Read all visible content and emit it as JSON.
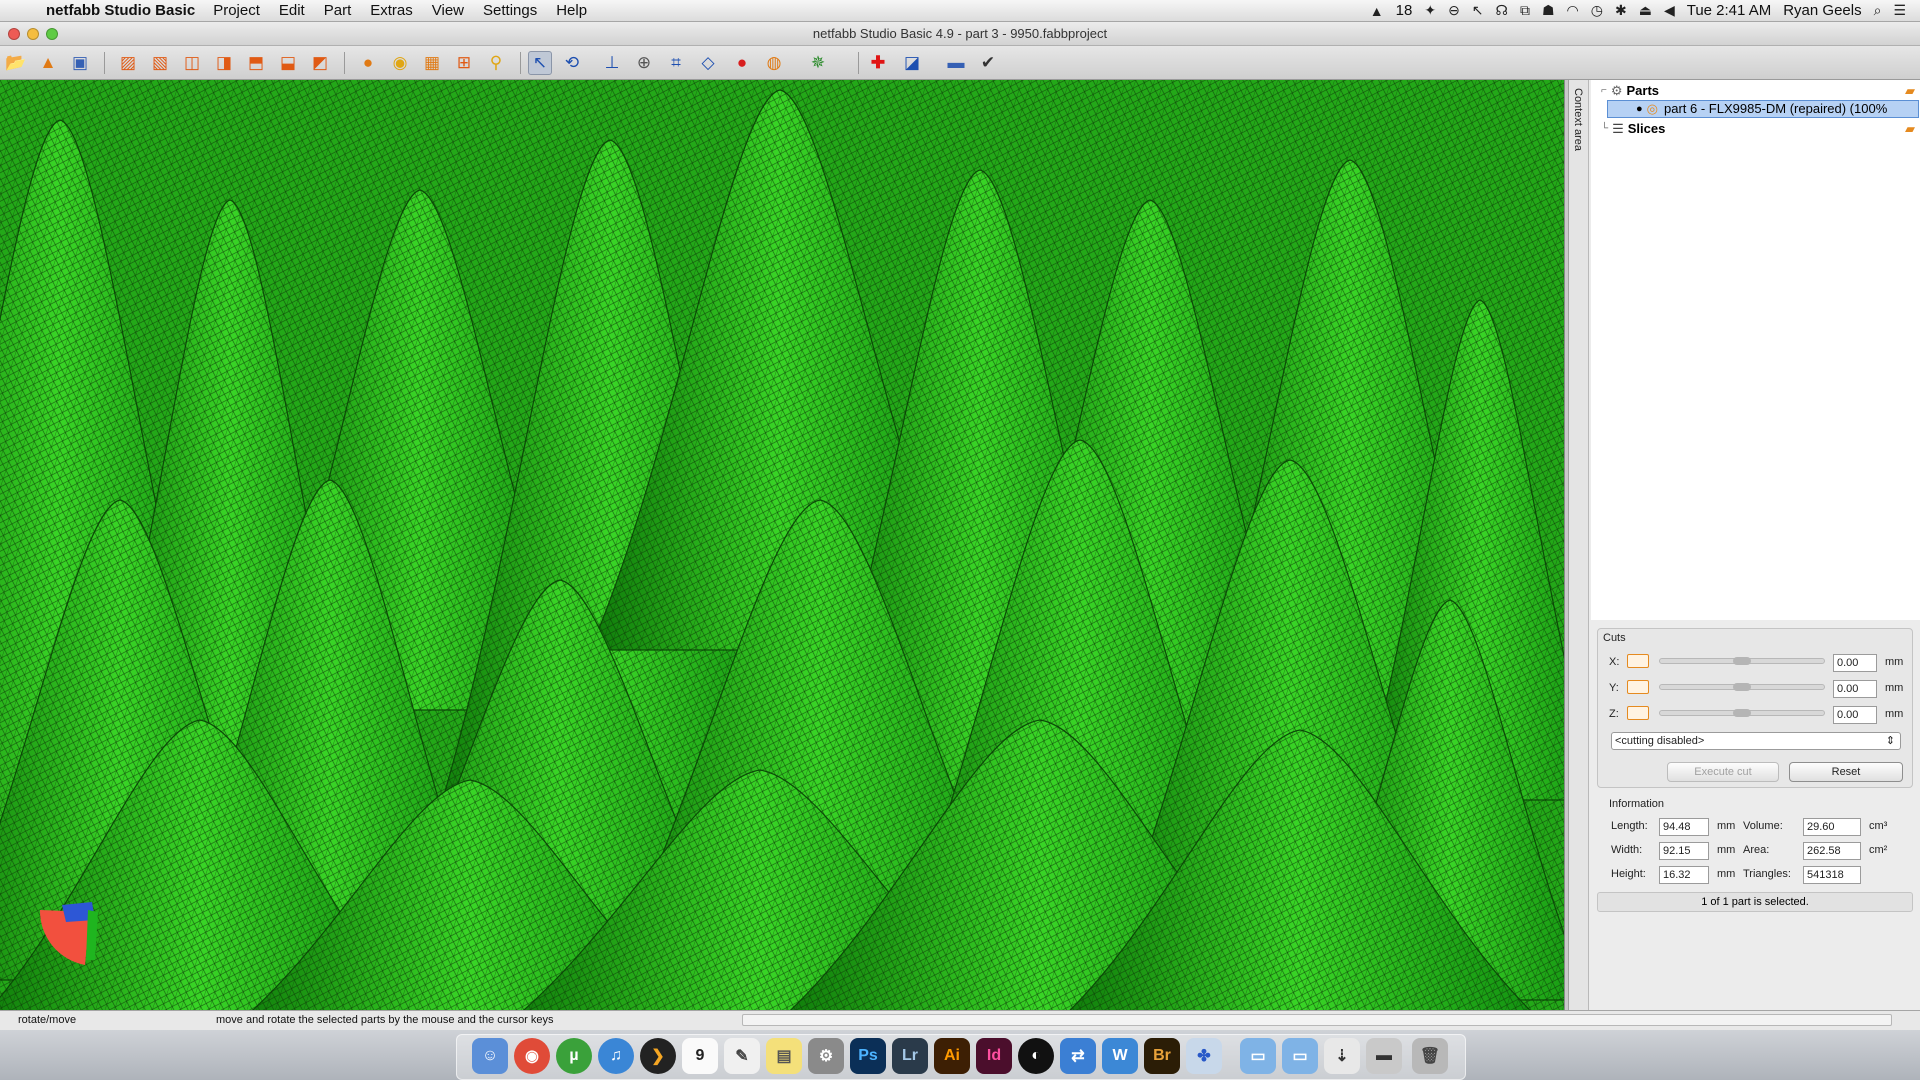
{
  "menubar": {
    "apple_icon": "apple-icon",
    "app_name": "netfabb Studio Basic",
    "menus": [
      "Project",
      "Edit",
      "Part",
      "Extras",
      "View",
      "Settings",
      "Help"
    ],
    "tray": {
      "notification_count": "18",
      "clock": "Tue 2:41 AM",
      "user": "Ryan Geels"
    }
  },
  "window": {
    "title": "netfabb Studio Basic 4.9 - part 3 - 9950.fabbproject"
  },
  "toolbar": {
    "buttons": [
      "open-project-icon",
      "add-part-icon",
      "import-icon",
      "view-front-icon",
      "view-back-icon",
      "view-left-icon",
      "view-right-icon",
      "view-top-icon",
      "view-bottom-icon",
      "view-iso-icon",
      "sphere-shade-icon",
      "solid-icon",
      "wireframe-icon",
      "zoom-fit-icon",
      "zoom-icon",
      "select-icon",
      "move-rotate-icon",
      "measure-icon",
      "pin-icon",
      "section-icon",
      "plane-icon",
      "color-icon",
      "globe-icon",
      "wand-icon",
      "repair-cross-icon",
      "slice-icon",
      "ruler-icon",
      "check-icon"
    ]
  },
  "context_panel": {
    "label": "Context area",
    "tree": [
      {
        "label": "Parts",
        "level": 0
      },
      {
        "label": "part 6 - FLX9985-DM (repaired) (100%",
        "level": 1,
        "selected": true
      },
      {
        "label": "Slices",
        "level": 0
      }
    ]
  },
  "cuts": {
    "section_label": "Cuts",
    "axes": [
      {
        "axis": "X:",
        "value": "0.00",
        "unit": "mm"
      },
      {
        "axis": "Y:",
        "value": "0.00",
        "unit": "mm"
      },
      {
        "axis": "Z:",
        "value": "0.00",
        "unit": "mm"
      }
    ],
    "mode": "<cutting disabled>",
    "execute_label": "Execute cut",
    "reset_label": "Reset"
  },
  "information": {
    "section_label": "Information",
    "length_label": "Length:",
    "length_value": "94.48",
    "width_label": "Width:",
    "width_value": "92.15",
    "height_label": "Height:",
    "height_value": "16.32",
    "mm": "mm",
    "volume_label": "Volume:",
    "volume_value": "29.60",
    "area_label": "Area:",
    "area_value": "262.58",
    "triangles_label": "Triangles:",
    "triangles_value": "541318",
    "cm3": "cm³",
    "cm2": "cm²",
    "status": "1 of 1 part is selected."
  },
  "statusbar": {
    "mode": "rotate/move",
    "hint": "move and rotate the selected parts by the mouse and the cursor keys"
  },
  "dock": {
    "apps": [
      "finder-icon",
      "chrome-icon",
      "utorrent-icon",
      "itunes-icon",
      "plex-icon",
      "calendar-icon",
      "textedit-icon",
      "stickies-icon",
      "system-prefs-icon",
      "photoshop-icon",
      "lightroom-icon",
      "illustrator-icon",
      "indesign-icon",
      "ableton-icon",
      "teamviewer-icon",
      "wunderlist-icon",
      "bridge-icon",
      "netfabb-icon",
      "folder-icon",
      "folder-icon",
      "downloads-icon",
      "drive-icon",
      "trash-icon"
    ],
    "labels": {
      "calendar": "9",
      "photoshop": "Ps",
      "lightroom": "Lr",
      "illustrator": "Ai",
      "indesign": "Id",
      "bridge": "Br"
    }
  },
  "colors": {
    "mesh_green": "#2fbf1e",
    "mesh_dark": "#0d5a08",
    "selection_blue": "#b6d1f4",
    "accent_orange": "#e58a1f"
  }
}
